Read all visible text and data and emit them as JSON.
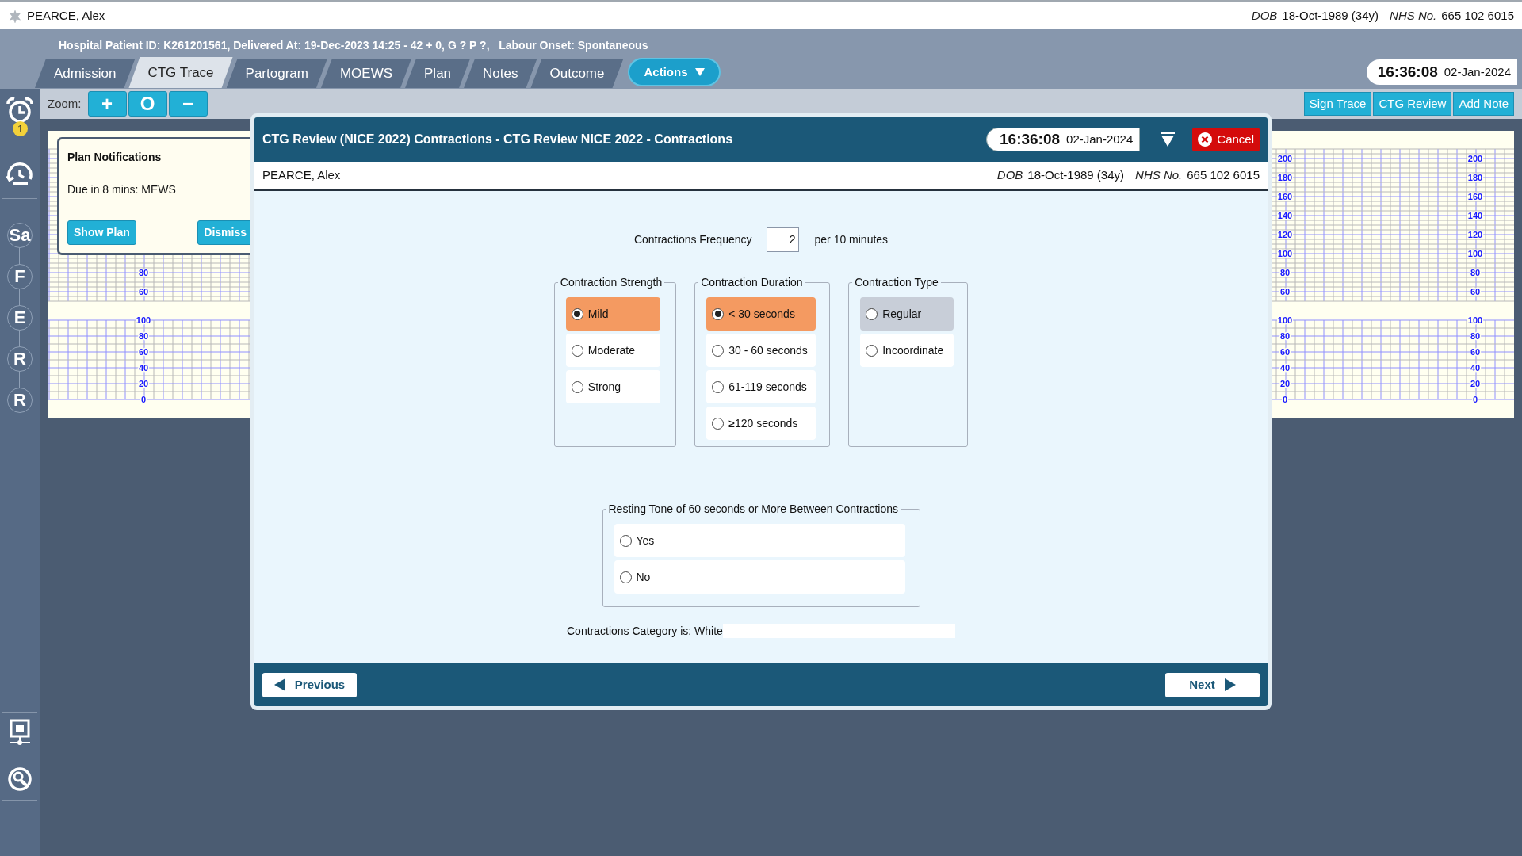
{
  "patient_banner": {
    "name": "PEARCE, Alex",
    "dob_label": "DOB",
    "dob": "18-Oct-1989 (34y)",
    "nhs_label": "NHS No.",
    "nhs": "665 102 6015"
  },
  "episode_info": "Hospital Patient ID: K261201561, Delivered At: 19-Dec-2023 14:25 - 42 + 0, G ? P ?,   Labour Onset: Spontaneous",
  "tabs": [
    {
      "label": "Admission",
      "selected": false
    },
    {
      "label": "CTG Trace",
      "selected": true
    },
    {
      "label": "Partogram",
      "selected": false
    },
    {
      "label": "MOEWS",
      "selected": false
    },
    {
      "label": "Plan",
      "selected": false
    },
    {
      "label": "Notes",
      "selected": false
    },
    {
      "label": "Outcome",
      "selected": false
    }
  ],
  "actions_button": "Actions",
  "clock": {
    "time": "16:36:08",
    "date": "02-Jan-2024"
  },
  "zoom": {
    "label": "Zoom:",
    "buttons": [
      "+",
      "O",
      "−"
    ]
  },
  "trace_buttons": [
    "Sign Trace",
    "CTG Review",
    "Add Note"
  ],
  "sidebar": {
    "alarm_badge": "1",
    "stages": [
      "Sa",
      "F",
      "E",
      "R",
      "R"
    ]
  },
  "trace": {
    "columns": [
      {
        "fhr_labels": [
          "80",
          "60"
        ],
        "toco_labels": [
          "100",
          "80",
          "60",
          "40",
          "20",
          "0"
        ]
      },
      {
        "fhr_labels": [
          "200",
          "180",
          "160",
          "140",
          "120",
          "100",
          "80",
          "60"
        ],
        "toco_labels": [
          "100",
          "80",
          "60",
          "40",
          "20",
          "0"
        ]
      },
      {
        "fhr_labels": [
          "200",
          "180",
          "160",
          "140",
          "120",
          "100",
          "80",
          "60"
        ],
        "toco_labels": [
          "100",
          "80",
          "60",
          "40",
          "20",
          "0"
        ]
      }
    ]
  },
  "notification": {
    "title": "Plan Notifications",
    "message": "Due in 8 mins: MEWS",
    "buttons": [
      "Show Plan",
      "Dismiss"
    ]
  },
  "dialog": {
    "title": "CTG Review (NICE 2022) Contractions - CTG Review NICE 2022 - Contractions",
    "clock": {
      "time": "16:36:08",
      "date": "02-Jan-2024"
    },
    "cancel": "Cancel",
    "patient": {
      "name": "PEARCE, Alex",
      "dob_label": "DOB",
      "dob": "18-Oct-1989 (34y)",
      "nhs_label": "NHS No.",
      "nhs": "665 102 6015"
    },
    "frequency": {
      "label": "Contractions Frequency",
      "value": "2",
      "unit": "per 10 minutes"
    },
    "groups": [
      {
        "title": "Contraction Strength",
        "options": [
          {
            "label": "Mild",
            "selected": true,
            "highlighted": false
          },
          {
            "label": "Moderate",
            "selected": false,
            "highlighted": false
          },
          {
            "label": "Strong",
            "selected": false,
            "highlighted": false
          }
        ]
      },
      {
        "title": "Contraction Duration",
        "options": [
          {
            "label": "< 30 seconds",
            "selected": true,
            "highlighted": false
          },
          {
            "label": "30 - 60 seconds",
            "selected": false,
            "highlighted": false
          },
          {
            "label": "61-119 seconds",
            "selected": false,
            "highlighted": false
          },
          {
            "label": "≥120 seconds",
            "selected": false,
            "highlighted": false
          }
        ]
      },
      {
        "title": "Contraction Type",
        "options": [
          {
            "label": "Regular",
            "selected": false,
            "highlighted": true
          },
          {
            "label": "Incoordinate",
            "selected": false,
            "highlighted": false
          }
        ]
      }
    ],
    "resting_tone": {
      "title": "Resting Tone of 60 seconds or More Between Contractions",
      "options": [
        {
          "label": "Yes",
          "selected": false,
          "highlighted": false
        },
        {
          "label": "No",
          "selected": false,
          "highlighted": false
        }
      ]
    },
    "category": "Contractions Category is: White",
    "previous": "Previous",
    "next": "Next"
  }
}
